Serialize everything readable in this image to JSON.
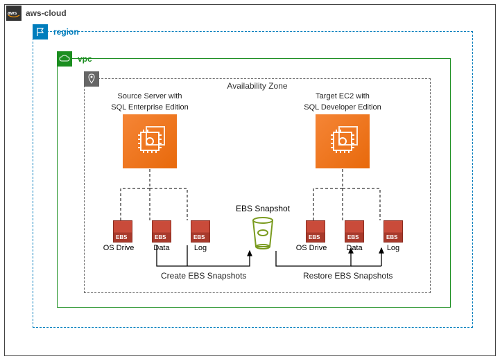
{
  "cloud": {
    "label": "aws-cloud"
  },
  "region": {
    "label": "region"
  },
  "vpc": {
    "label": "vpc"
  },
  "az": {
    "label": "Availability Zone"
  },
  "source": {
    "title_line1": "Source Server with",
    "title_line2": "SQL Enterprise Edition",
    "volumes": {
      "os": "OS Drive",
      "data": "Data",
      "log": "Log",
      "badge": "EBS"
    }
  },
  "target": {
    "title_line1": "Target EC2 with",
    "title_line2": "SQL Developer Edition",
    "volumes": {
      "os": "OS Drive",
      "data": "Data",
      "log": "Log",
      "badge": "EBS"
    }
  },
  "snapshot": {
    "label": "EBS Snapshot"
  },
  "actions": {
    "create": "Create EBS Snapshots",
    "restore": "Restore EBS Snapshots"
  }
}
